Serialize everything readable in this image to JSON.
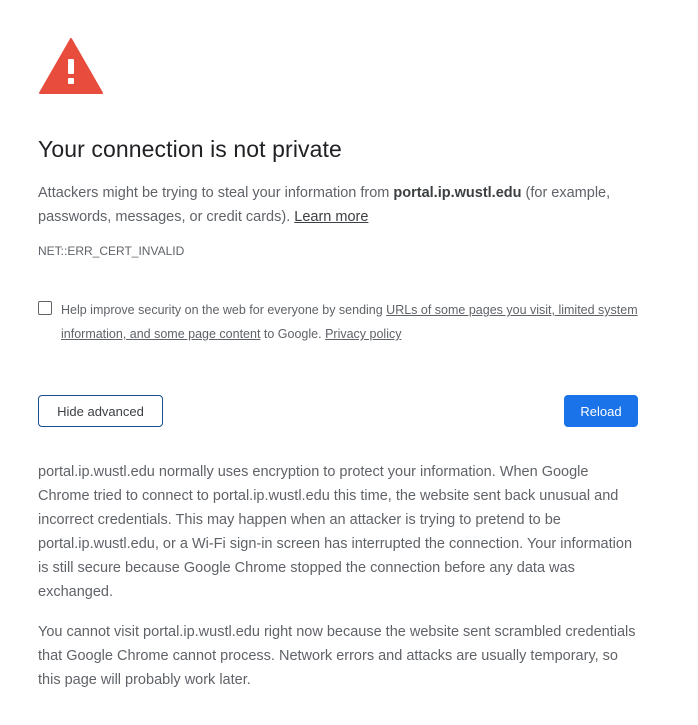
{
  "icons": {
    "warning": "warning-triangle-icon"
  },
  "colors": {
    "warning_red": "#e74c3c",
    "primary_blue": "#1a73e8",
    "text_dark": "#202124",
    "text_gray": "#5f6368"
  },
  "heading": "Your connection is not private",
  "summary": {
    "prefix": "Attackers might be trying to steal your information from ",
    "domain": "portal.ip.wustl.edu",
    "suffix": " (for example, passwords, messages, or credit cards). ",
    "learn_more": "Learn more"
  },
  "error_code": "NET::ERR_CERT_INVALID",
  "optin": {
    "checked": false,
    "prefix": "Help improve security on the web for everyone by sending ",
    "link": "URLs of some pages you visit, limited system information, and some page content",
    "middle": " to Google. ",
    "privacy_link": "Privacy policy"
  },
  "buttons": {
    "hide_advanced": "Hide advanced",
    "reload": "Reload"
  },
  "details": {
    "paragraph1": "portal.ip.wustl.edu normally uses encryption to protect your information. When Google Chrome tried to connect to portal.ip.wustl.edu this time, the website sent back unusual and incorrect credentials. This may happen when an attacker is trying to pretend to be portal.ip.wustl.edu, or a Wi-Fi sign-in screen has interrupted the connection. Your information is still secure because Google Chrome stopped the connection before any data was exchanged.",
    "paragraph2": "You cannot visit portal.ip.wustl.edu right now because the website sent scrambled credentials that Google Chrome cannot process. Network errors and attacks are usually temporary, so this page will probably work later."
  }
}
